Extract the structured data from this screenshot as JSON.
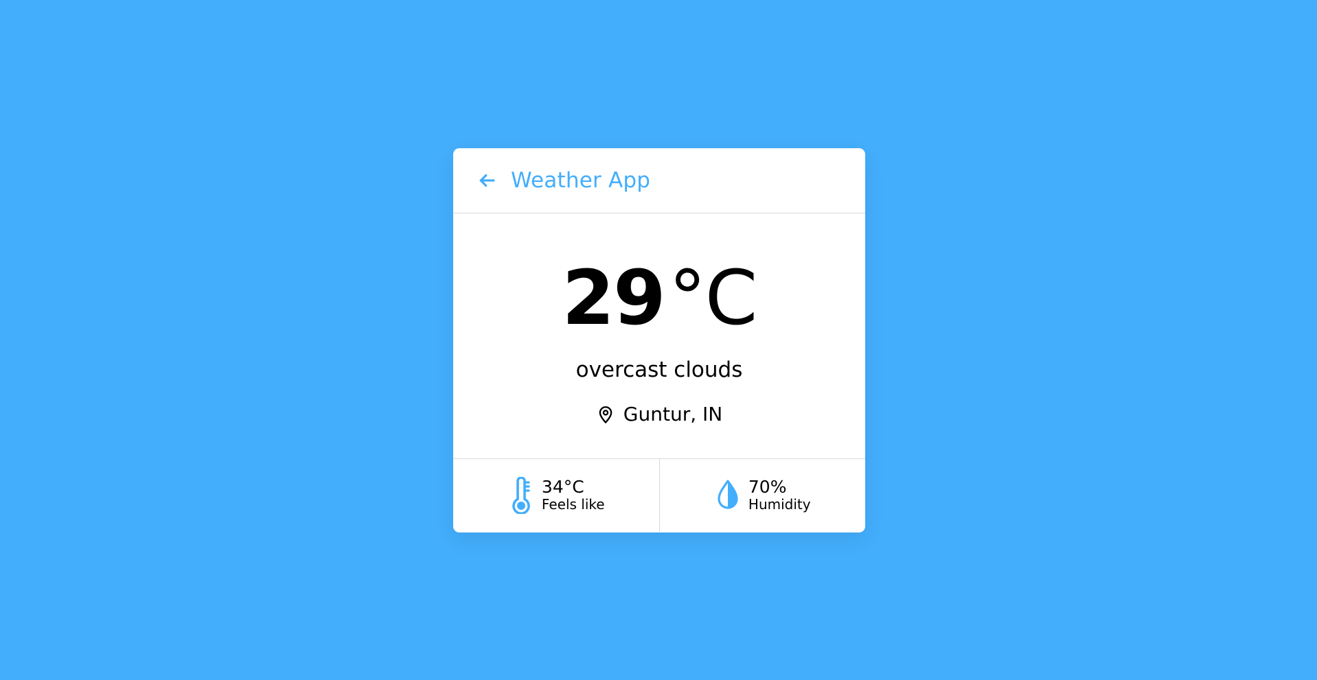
{
  "colors": {
    "background": "#43aefc",
    "accent": "#43aefc",
    "card": "#ffffff",
    "text": "#000000"
  },
  "header": {
    "back_icon": "arrow-left-icon",
    "title": "Weather App"
  },
  "weather": {
    "temperature": "29",
    "unit": "°C",
    "description": "overcast clouds",
    "location_icon": "map-pin-icon",
    "location": "Guntur, IN"
  },
  "details": {
    "feels_like": {
      "icon": "thermometer-icon",
      "value": "34°C",
      "label": "Feels like"
    },
    "humidity": {
      "icon": "water-drop-icon",
      "value": "70%",
      "label": "Humidity"
    }
  }
}
